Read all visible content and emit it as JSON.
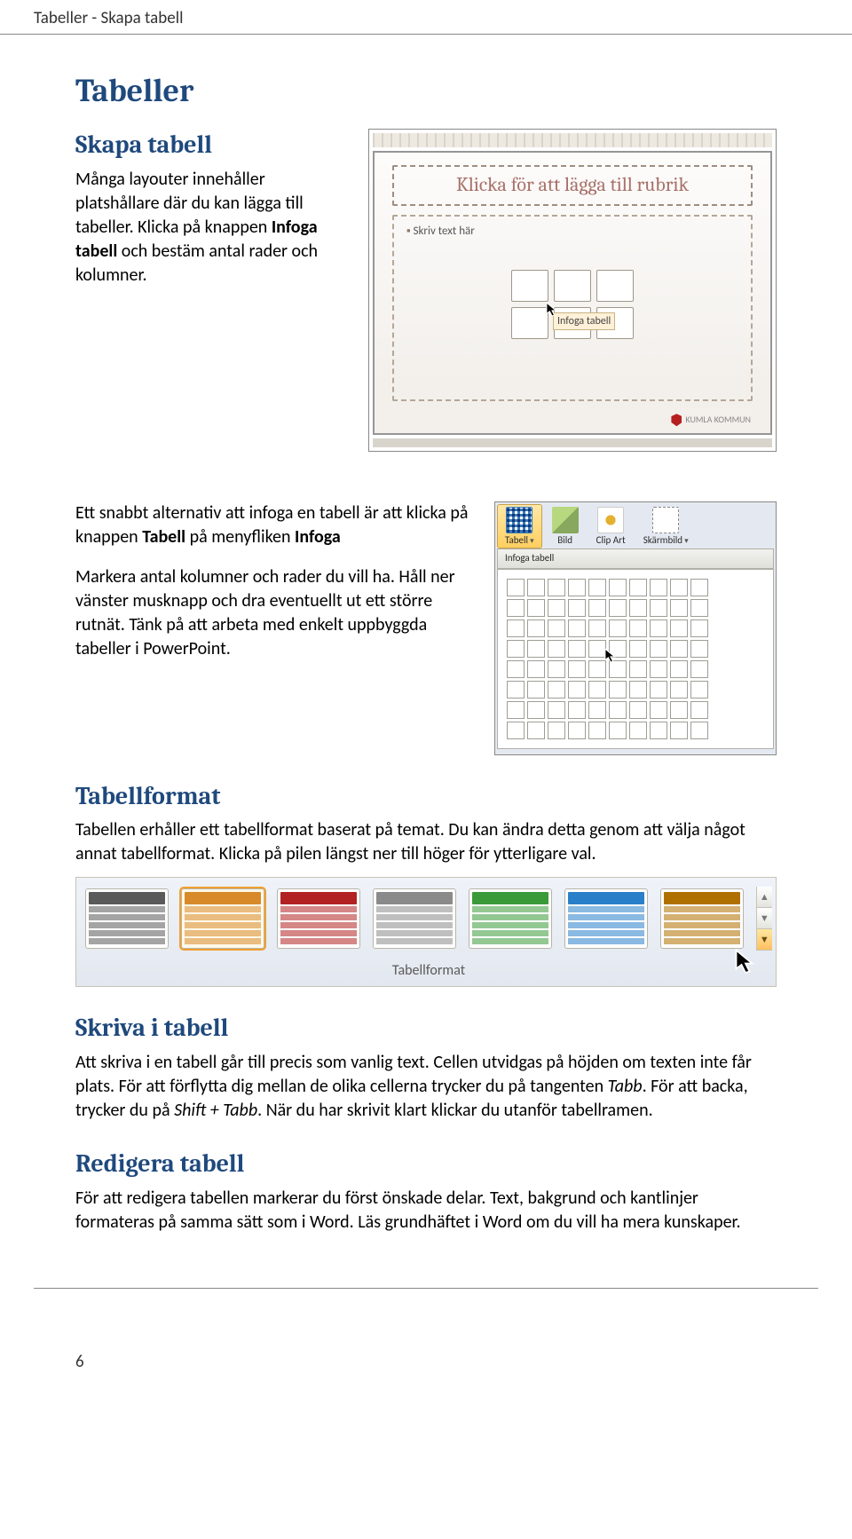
{
  "header": {
    "breadcrumb": "Tabeller - Skapa tabell"
  },
  "title": "Tabeller",
  "sections": {
    "skapa": {
      "heading": "Skapa tabell",
      "p1a": "Många layouter innehåller platshållare där du kan lägga till tabeller. Klicka på knappen ",
      "p1b": "Infoga tabell",
      "p1c": " och bestäm antal rader och kolumner.",
      "p2a": "Ett snabbt alternativ att infoga en tabell är att klicka på knappen ",
      "p2b": "Tabell",
      "p2c": " på menyfliken ",
      "p2d": "Infoga",
      "p3": "Markera antal kolumner och rader du vill ha. Håll ner vänster musknapp och dra eventuellt ut ett större rutnät. Tänk på att arbeta med enkelt uppbyggda tabeller i PowerPoint."
    },
    "format": {
      "heading": "Tabellformat",
      "p": "Tabellen erhåller ett tabellformat baserat på temat. Du kan ändra detta genom att välja något annat tabellformat. Klicka på pilen längst ner till höger för ytterligare val."
    },
    "skriva": {
      "heading": "Skriva i tabell",
      "p_a": "Att skriva i en tabell går till precis som vanlig text. Cellen utvidgas på höjden om texten inte får plats. För att förflytta dig mellan de olika cellerna trycker du på tangenten ",
      "p_b": "Tabb",
      "p_c": ". För att backa, trycker du på ",
      "p_d": "Shift + Tabb",
      "p_e": ". När du har skrivit klart klickar du utanför tabellramen."
    },
    "redigera": {
      "heading": "Redigera tabell",
      "p": "För att redigera tabellen markerar du först önskade delar. Text, bakgrund och kantlinjer formateras på samma sätt som i Word. Läs grundhäftet i Word om du vill ha mera kunskaper."
    }
  },
  "screenshot_slide": {
    "title_placeholder": "Klicka för att lägga till rubrik",
    "bullet_text": "Skriv text här",
    "insert_label": "Infoga tabell",
    "brand": "KUMLA KOMMUN"
  },
  "screenshot_ribbon": {
    "buttons": {
      "tabell": "Tabell",
      "bild": "Bild",
      "clip": "Clip Art",
      "skarm": "Skärmbild"
    },
    "submenu": "Infoga tabell"
  },
  "screenshot_gallery": {
    "label": "Tabellformat",
    "colors": [
      "#5a5a5a",
      "#d88a2a",
      "#b22222",
      "#8a8a8a",
      "#3a9a3a",
      "#2a7fc9",
      "#b07000"
    ]
  },
  "page_number": "6"
}
